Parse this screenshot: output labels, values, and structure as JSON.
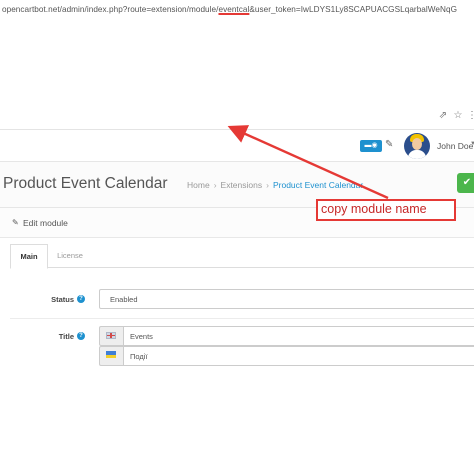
{
  "browser": {
    "url_prefix": "opencartbot.net/admin/index.php?route=extension/module/",
    "url_highlight": "eventcal",
    "url_suffix": "&user_token=IwLDYS1Ly8SCAPUACGSLqarbalWeNqG",
    "icons": [
      "share-icon",
      "star-icon",
      "menu-icon"
    ]
  },
  "header": {
    "user_name": "John Doe",
    "badge_icon": "notification-icon"
  },
  "page": {
    "title": "Product Event Calendar",
    "breadcrumbs": [
      "Home",
      "Extensions",
      "Product Event Calendar"
    ]
  },
  "panel": {
    "heading": "Edit module",
    "tabs": [
      {
        "label": "Main",
        "active": true
      },
      {
        "label": "License",
        "active": false
      }
    ],
    "fields": {
      "status_label": "Status",
      "status_value": "Enabled",
      "title_label": "Title",
      "title_values": [
        {
          "lang": "en-gb",
          "value": "Events"
        },
        {
          "lang": "uk-ua",
          "value": "Події"
        }
      ]
    }
  },
  "annotation": {
    "text": "copy module name",
    "color": "#e53935"
  },
  "colors": {
    "accent": "#1e91cf",
    "save": "#4cb64c"
  }
}
